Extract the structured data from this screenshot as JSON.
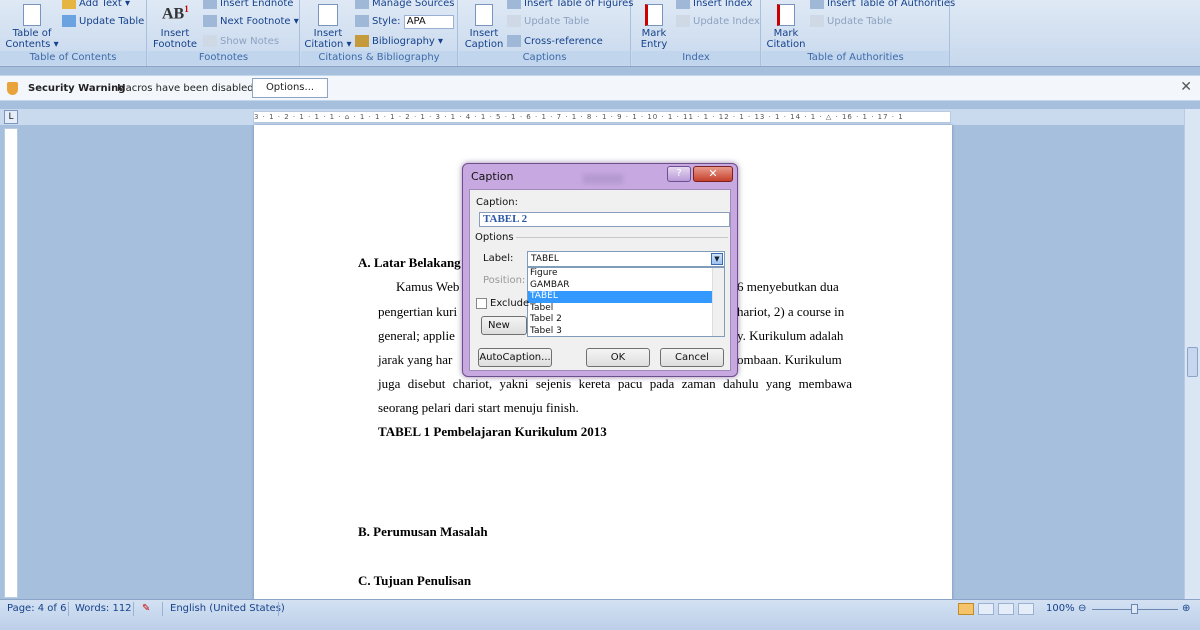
{
  "ribbon": {
    "toc": {
      "add_text": "Add Text",
      "update_table": "Update Table",
      "table_of_contents": "Table of Contents",
      "group": "Table of Contents"
    },
    "footnotes": {
      "insert_endnote": "Insert Endnote",
      "next_footnote": "Next Footnote",
      "show_notes": "Show Notes",
      "insert_footnote": "Insert Footnote",
      "group": "Footnotes"
    },
    "citations": {
      "manage_sources": "Manage Sources",
      "style_label": "Style:",
      "style_value": "APA",
      "bibliography": "Bibliography",
      "insert_citation": "Insert Citation",
      "group": "Citations & Bibliography"
    },
    "captions": {
      "insert_table_of_figures": "Insert Table of Figures",
      "update_table": "Update Table",
      "cross_reference": "Cross-reference",
      "insert_caption": "Insert Caption",
      "group": "Captions"
    },
    "index": {
      "insert_index": "Insert Index",
      "update_index": "Update Index",
      "mark_entry": "Mark Entry",
      "group": "Index"
    },
    "authorities": {
      "insert_table_of_authorities": "Insert Table of Authorities",
      "update_table": "Update Table",
      "mark_citation": "Mark Citation",
      "group": "Table of Authorities"
    }
  },
  "security_bar": {
    "title": "Security Warning",
    "message": "Macros have been disabled.",
    "options_button": "Options..."
  },
  "ruler": {
    "marks": "3 · 1 · 2 · 1 · 1 · 1 · ⌂ · 1 · 1 · 1 · 2 · 1 · 3 · 1 · 4 · 1 · 5 · 1 · 6 · 1 · 7 · 1 · 8 · 1 · 9 · 1 · 10 · 1 · 11 · 1 · 12 · 1 · 13 · 1 · 14 · 1 · △ · 16 · 1 · 17 · 1"
  },
  "document": {
    "heading_a": "A.  Latar Belakang",
    "para_lines": [
      "Kamus Webster 1996 menyebutkan dua",
      "pengertian kurikulum, yaitu: 1) a running course, or race course, especially a chariot, 2) a course in",
      "general; applied to the course of study in a school or university. Kurikulum adalah",
      "jarak yang harus ditempuh oleh pelari dari garis start sampai finish dalam perlombaan. Kurikulum",
      "juga disebut chariot, yakni sejenis kereta pacu pada zaman dahulu yang membawa",
      "seorang pelari dari start menuju finish."
    ],
    "visible_right": [
      "6 menyebutkan dua",
      "hariot, 2) a course in",
      "y. Kurikulum adalah",
      "ombaan. Kurikulum"
    ],
    "visible_left": [
      "Kamus Web",
      "pengertian kuri",
      "general; applie",
      "jarak yang har"
    ],
    "line5": "juga disebut chariot, yakni sejenis kereta pacu pada zaman dahulu yang membawa",
    "line6": "seorang pelari dari start menuju finish.",
    "table_caption": "TABEL 1 Pembelajaran Kurikulum 2013",
    "heading_b": "B.  Perumusan Masalah",
    "heading_c": "C.  Tujuan Penulisan"
  },
  "dialog": {
    "title": "Caption",
    "caption_label": "Caption:",
    "caption_value": "TABEL 2",
    "options_label": "Options",
    "label_label": "Label:",
    "label_value": "TABEL",
    "position_label": "Position:",
    "exclude_label": "Exclude",
    "new_label_button": "New Label",
    "list_options": [
      "Figure",
      "GAMBAR",
      "TABEL",
      "Tabel",
      "Tabel 2",
      "Tabel 3"
    ],
    "selected_option": "TABEL",
    "autocaption_button": "AutoCaption...",
    "ok_button": "OK",
    "cancel_button": "Cancel"
  },
  "status": {
    "page": "Page: 4 of 6",
    "words": "Words: 112",
    "language": "English (United States)",
    "zoom": "100%"
  },
  "colors": {
    "ribbon": "#c7d8ed",
    "dialog_frame": "#c8a8e0",
    "list_selected": "#3399ff"
  }
}
